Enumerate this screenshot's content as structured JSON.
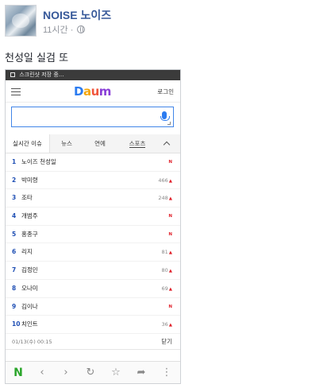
{
  "post": {
    "author": "NOISE 노이즈",
    "time": "11시간",
    "separator": "·",
    "caption": "천성일 실검 또"
  },
  "screenshot": {
    "status_text": "스크린샷 저장 중...",
    "brand": {
      "logo_letters": [
        "D",
        "a",
        "u",
        "m"
      ],
      "colors": [
        "#2b7bf0",
        "#f5a60a",
        "#f0563c",
        "#8a3fd8"
      ]
    },
    "login_label": "로그인",
    "search": {
      "value": "",
      "placeholder": ""
    },
    "tabs": [
      "실시간 이슈",
      "뉴스",
      "연예",
      "스포츠"
    ],
    "ranks": [
      {
        "num": "1",
        "keyword": "노이즈 천성일",
        "value": "",
        "new": true
      },
      {
        "num": "2",
        "keyword": "박미령",
        "value": "466",
        "new": false
      },
      {
        "num": "3",
        "keyword": "조타",
        "value": "248",
        "new": false
      },
      {
        "num": "4",
        "keyword": "개범주",
        "value": "",
        "new": true
      },
      {
        "num": "5",
        "keyword": "홍종구",
        "value": "",
        "new": true
      },
      {
        "num": "6",
        "keyword": "리지",
        "value": "81",
        "new": false
      },
      {
        "num": "7",
        "keyword": "김정민",
        "value": "80",
        "new": false
      },
      {
        "num": "8",
        "keyword": "오나미",
        "value": "69",
        "new": false
      },
      {
        "num": "9",
        "keyword": "김이나",
        "value": "",
        "new": true
      },
      {
        "num": "10",
        "keyword": "치인트",
        "value": "36",
        "new": false
      }
    ],
    "new_badge": "N",
    "up_arrow": "▲",
    "timestamp": "01/13(수) 00:15",
    "close_label": "닫기",
    "browser_icons": [
      "N",
      "‹",
      "›",
      "↻",
      "☆",
      "➦",
      "⋮"
    ]
  }
}
